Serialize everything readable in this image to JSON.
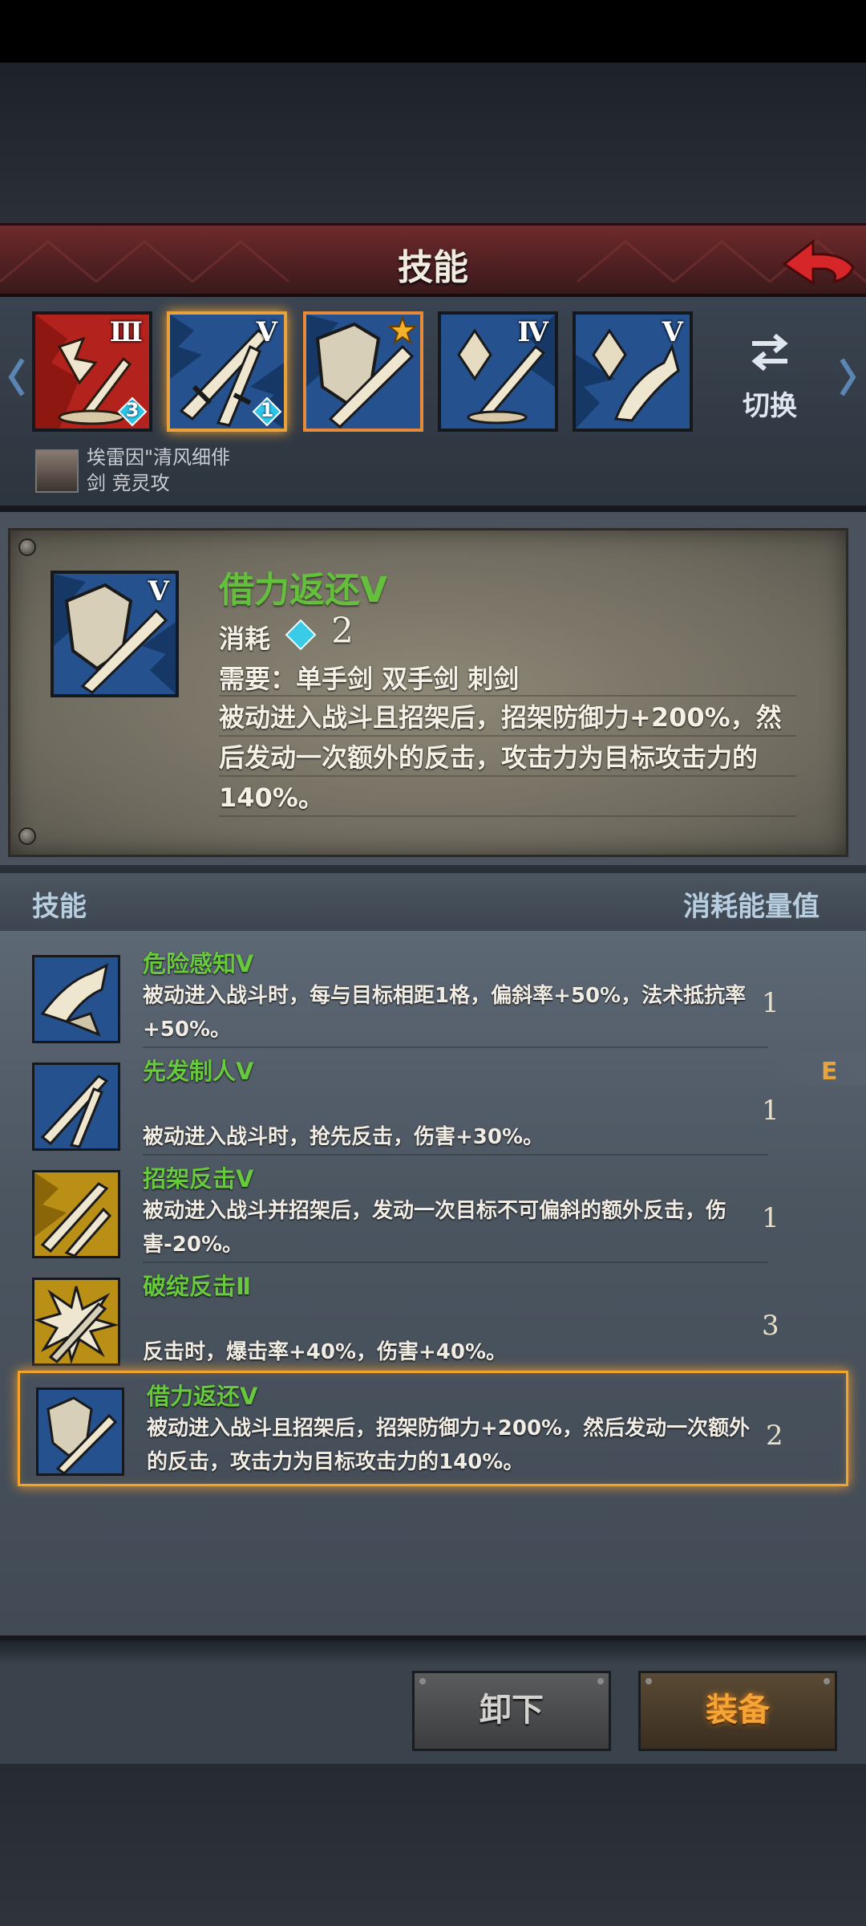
{
  "header": {
    "title": "技能"
  },
  "top_slots": [
    {
      "roman": "Ⅲ",
      "gem": "3"
    },
    {
      "roman": "Ⅴ",
      "gem": "1"
    },
    {
      "roman": ""
    },
    {
      "roman": "Ⅳ"
    },
    {
      "roman": "Ⅴ"
    }
  ],
  "switch": {
    "label": "切换"
  },
  "hero": {
    "line1": "埃雷因\"清风细俳",
    "line2": "剑 竞灵攻"
  },
  "detail": {
    "roman": "Ⅴ",
    "name": "借力返还Ⅴ",
    "cost_label": "消耗",
    "cost": "2",
    "requirements": "需要：单手剑  双手剑  刺剑",
    "description": "被动进入战斗且招架后，招架防御力+200%，然后发动一次额外的反击，攻击力为目标攻击力的140%。"
  },
  "list_header": {
    "left": "技能",
    "right": "消耗能量值"
  },
  "skills": [
    {
      "name": "危险感知Ⅴ",
      "description": "被动进入战斗时，每与目标相距1格，偏斜率+50%，法术抵抗率+50%。",
      "cost": "1"
    },
    {
      "name": "先发制人Ⅴ",
      "description": "被动进入战斗时，抢先反击，伤害+30%。",
      "cost": "1"
    },
    {
      "name": "招架反击Ⅴ",
      "description": "被动进入战斗并招架后，发动一次目标不可偏斜的额外反击，伤害-20%。",
      "cost": "1"
    },
    {
      "name": "破绽反击Ⅱ",
      "description": "反击时，爆击率+40%，伤害+40%。",
      "cost": "3"
    },
    {
      "name": "借力返还Ⅴ",
      "description": "被动进入战斗且招架后，招架防御力+200%，然后发动一次额外的反击，攻击力为目标攻击力的140%。",
      "cost": "2"
    }
  ],
  "equip_badge": "E",
  "buttons": {
    "unequip": "卸下",
    "equip": "装备"
  },
  "colors": {
    "skill_name": "#68c83e",
    "accent": "#f1a32d",
    "header": "#5c2326"
  }
}
